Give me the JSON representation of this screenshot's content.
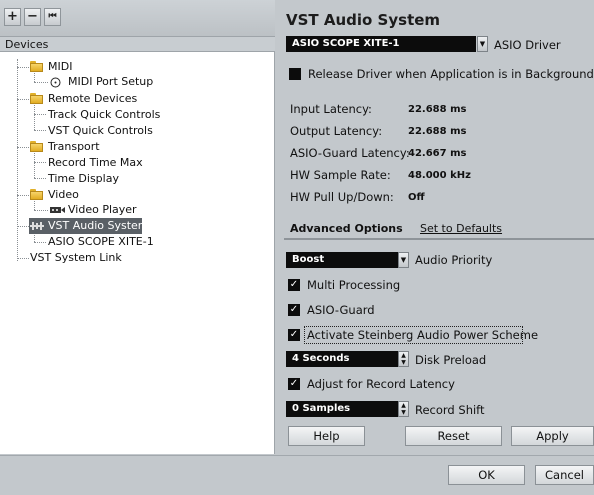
{
  "toolbar": {
    "add": "+",
    "remove": "−",
    "reset": "⏮"
  },
  "devices": {
    "header": "Devices",
    "tree": [
      {
        "label": "MIDI",
        "type": "folder"
      },
      {
        "label": "MIDI Port Setup",
        "type": "item"
      },
      {
        "label": "Remote Devices",
        "type": "folder"
      },
      {
        "label": "Track Quick Controls",
        "type": "item"
      },
      {
        "label": "VST Quick Controls",
        "type": "item"
      },
      {
        "label": "Transport",
        "type": "folder"
      },
      {
        "label": "Record Time Max",
        "type": "item"
      },
      {
        "label": "Time Display",
        "type": "item"
      },
      {
        "label": "Video",
        "type": "folder"
      },
      {
        "label": "Video Player",
        "type": "item"
      },
      {
        "label": "VST Audio System",
        "type": "item",
        "selected": true
      },
      {
        "label": "ASIO SCOPE XITE-1",
        "type": "item"
      },
      {
        "label": "VST System Link",
        "type": "item"
      }
    ]
  },
  "panel": {
    "title": "VST Audio System",
    "asio_driver": {
      "value": "ASIO SCOPE XITE-1",
      "label": "ASIO Driver"
    },
    "release_driver": {
      "label": "Release Driver when Application is in Background",
      "checked": false
    },
    "info": [
      {
        "label": "Input Latency:",
        "value": "22.688 ms"
      },
      {
        "label": "Output Latency:",
        "value": "22.688 ms"
      },
      {
        "label": "ASIO-Guard Latency:",
        "value": "42.667 ms"
      },
      {
        "label": "HW Sample Rate:",
        "value": "48.000 kHz"
      },
      {
        "label": "HW Pull Up/Down:",
        "value": "Off"
      }
    ],
    "advanced_label": "Advanced Options",
    "set_defaults": "Set to Defaults",
    "audio_priority": {
      "value": "Boost",
      "label": "Audio Priority"
    },
    "multi_processing": {
      "label": "Multi Processing",
      "checked": true
    },
    "asio_guard": {
      "label": "ASIO-Guard",
      "checked": true
    },
    "power_scheme": {
      "label": "Activate Steinberg Audio Power Scheme",
      "checked": true
    },
    "disk_preload": {
      "value": "4 Seconds",
      "label": "Disk Preload"
    },
    "adjust_record": {
      "label": "Adjust for Record Latency",
      "checked": true
    },
    "record_shift": {
      "value": "0 Samples",
      "label": "Record Shift"
    },
    "buttons": {
      "help": "Help",
      "reset": "Reset",
      "apply": "Apply"
    }
  },
  "footer": {
    "ok": "OK",
    "cancel": "Cancel"
  },
  "colors": {
    "panel_bg": "#c3c8cc",
    "selected_row": "#5a6066",
    "dropdown": "#0c0c0c"
  }
}
